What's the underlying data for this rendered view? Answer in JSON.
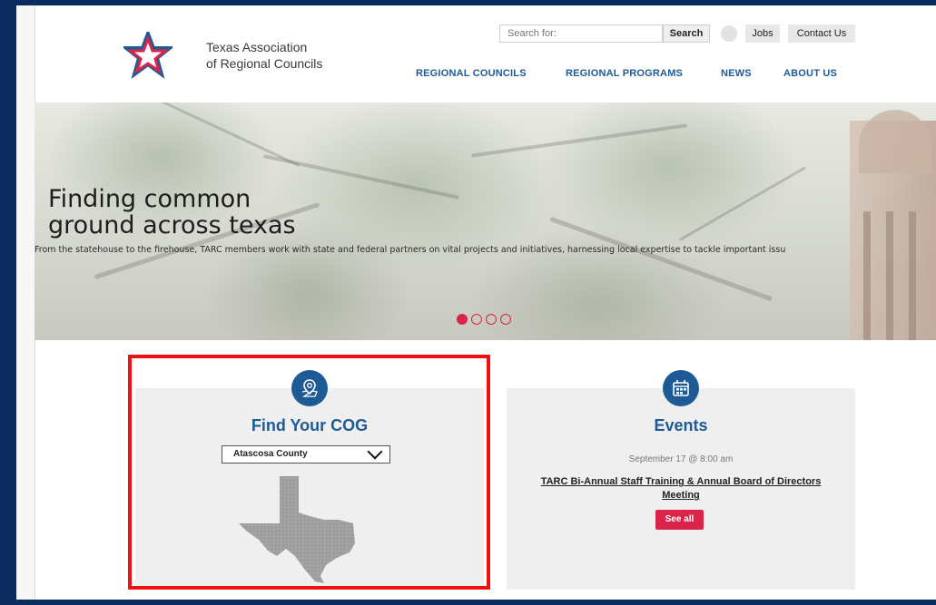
{
  "header": {
    "org_name_line1": "Texas Association",
    "org_name_line2": "of Regional Councils",
    "search_placeholder": "Search for:",
    "search_button": "Search",
    "jobs": "Jobs",
    "contact": "Contact Us"
  },
  "nav": {
    "items": [
      "REGIONAL COUNCILS",
      "REGIONAL PROGRAMS",
      "NEWS",
      "ABOUT US"
    ]
  },
  "hero": {
    "title_line1": "Finding common",
    "title_line2": "ground across texas",
    "subtitle": "From the statehouse to the firehouse, TARC members work with state and federal partners on vital projects and initiatives, harnessing local expertise to tackle important issu",
    "slide_count": 4,
    "active_slide": 1
  },
  "cog_card": {
    "title": "Find Your COG",
    "selected_county": "Atascosa County"
  },
  "events_card": {
    "title": "Events",
    "date": "September 17 @ 8:00 am",
    "event_title": "TARC Bi-Annual Staff Training & Annual Board of Directors Meeting",
    "see_all": "See all"
  },
  "colors": {
    "brand_blue": "#1e5a96",
    "accent_red": "#d9254a",
    "page_bg": "#0b2a5e",
    "highlight_red": "#f01010"
  }
}
